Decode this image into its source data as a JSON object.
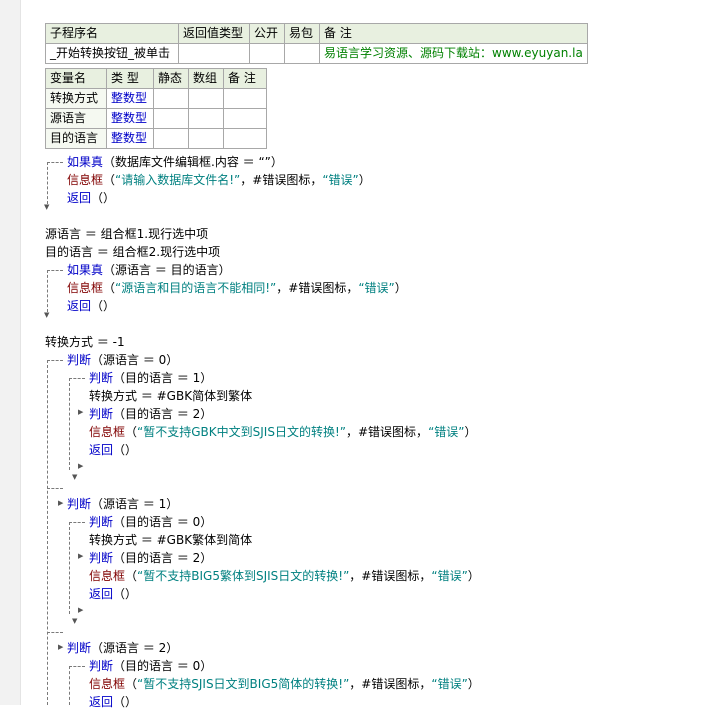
{
  "sub_table": {
    "headers": [
      "子程序名",
      "返回值类型",
      "公开",
      "易包",
      "备 注"
    ],
    "name": "_开始转换按钮_被单击",
    "remark": "易语言学习资源、源码下载站：www.eyuyan.la"
  },
  "var_table": {
    "headers": [
      "变量名",
      "类 型",
      "静态",
      "数组",
      "备 注"
    ],
    "rows": [
      {
        "name": "转换方式",
        "type": "整数型"
      },
      {
        "name": "源语言",
        "type": "整数型"
      },
      {
        "name": "目的语言",
        "type": "整数型"
      }
    ]
  },
  "code": {
    "l1": {
      "kw": "如果真",
      "rest": "（数据库文件编辑框.内容 ＝ “”）"
    },
    "l2": {
      "fn": "信息框",
      "open": "（",
      "str1": "“请输入数据库文件名!”",
      "mid": "，#错误图标，",
      "str2": "“错误”",
      "close": "）"
    },
    "l3": {
      "kw": "返回",
      "rest": "（）"
    },
    "l4": "源语言 ＝ 组合框1.现行选中项",
    "l5": "目的语言 ＝ 组合框2.现行选中项",
    "l6": {
      "kw": "如果真",
      "rest": "（源语言 ＝ 目的语言）"
    },
    "l7": {
      "fn": "信息框",
      "open": "（",
      "str1": "“源语言和目的语言不能相同!”",
      "mid": "，#错误图标，",
      "str2": "“错误”",
      "close": "）"
    },
    "l8": {
      "kw": "返回",
      "rest": "（）"
    },
    "l9": "转换方式 ＝ -1",
    "l10": {
      "kw": "判断",
      "rest": "（源语言 ＝ 0）"
    },
    "l11": {
      "kw": "判断",
      "rest": "（目的语言 ＝ 1）"
    },
    "l12": "转换方式 ＝ #GBK简体到繁体",
    "l13": {
      "kw": "判断",
      "rest": "（目的语言 ＝ 2）"
    },
    "l14": {
      "fn": "信息框",
      "open": "（",
      "str1": "“暂不支持GBK中文到SJIS日文的转换!”",
      "mid": "，#错误图标，",
      "str2": "“错误”",
      "close": "）"
    },
    "l15": {
      "kw": "返回",
      "rest": "（）"
    },
    "l16": {
      "kw": "判断",
      "rest": "（源语言 ＝ 1）"
    },
    "l17": {
      "kw": "判断",
      "rest": "（目的语言 ＝ 0）"
    },
    "l18": "转换方式 ＝ #GBK繁体到简体",
    "l19": {
      "kw": "判断",
      "rest": "（目的语言 ＝ 2）"
    },
    "l20": {
      "fn": "信息框",
      "open": "（",
      "str1": "“暂不支持BIG5繁体到SJIS日文的转换!”",
      "mid": "，#错误图标，",
      "str2": "“错误”",
      "close": "）"
    },
    "l21": {
      "kw": "返回",
      "rest": "（）"
    },
    "l22": {
      "kw": "判断",
      "rest": "（源语言 ＝ 2）"
    },
    "l23": {
      "kw": "判断",
      "rest": "（目的语言 ＝ 0）"
    },
    "l24": {
      "fn": "信息框",
      "open": "（",
      "str1": "“暂不支持SJIS日文到BIG5简体的转换!”",
      "mid": "，#错误图标，",
      "str2": "“错误”",
      "close": "）"
    },
    "l25": {
      "kw": "返回",
      "rest": "（）"
    }
  },
  "colors": {
    "keyword": "#0000c8",
    "function": "#800000",
    "string": "#008080",
    "header_bg": "#e8f0e0",
    "remark": "#008000"
  }
}
